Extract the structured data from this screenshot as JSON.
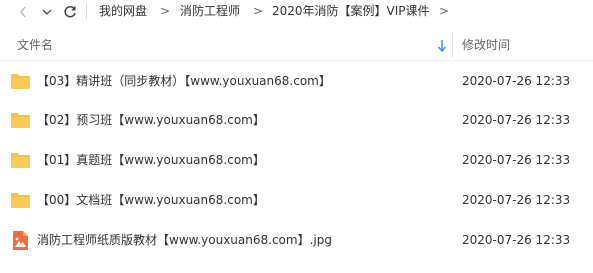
{
  "nav": {
    "breadcrumbs": [
      "我的网盘",
      "消防工程师",
      "2020年消防【案例】VIP课件"
    ],
    "chevron": ">"
  },
  "header": {
    "name_label": "文件名",
    "date_label": "修改时间"
  },
  "files": [
    {
      "name": "【03】精讲班（同步教材）【www.youxuan68.com】",
      "modified": "2020-07-26 12:33",
      "type": "folder"
    },
    {
      "name": "【02】预习班【www.youxuan68.com】",
      "modified": "2020-07-26 12:33",
      "type": "folder"
    },
    {
      "name": "【01】真题班【www.youxuan68.com】",
      "modified": "2020-07-26 12:33",
      "type": "folder"
    },
    {
      "name": "【00】文档班【www.youxuan68.com】",
      "modified": "2020-07-26 12:33",
      "type": "folder"
    },
    {
      "name": "消防工程师纸质版教材【www.youxuan68.com】.jpg",
      "modified": "2020-07-26 12:33",
      "type": "image"
    }
  ],
  "colors": {
    "folder": "#f5c342",
    "image_file": "#f26d3d",
    "sort_arrow": "#3b8cff"
  }
}
